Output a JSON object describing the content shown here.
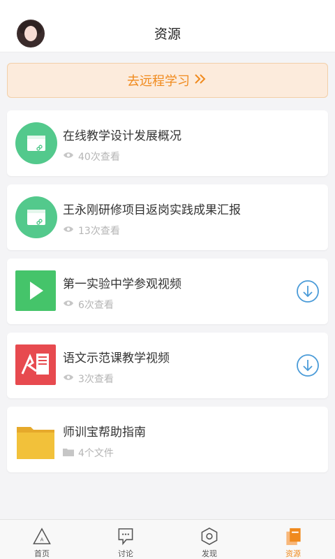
{
  "header": {
    "title": "资源",
    "avatar": "user-avatar"
  },
  "banner": {
    "label": "去远程学习",
    "icon": "double-chevron-right-icon",
    "color": "#f08a1d"
  },
  "resources": [
    {
      "title": "在线教学设计发展概况",
      "meta": "40次查看",
      "type": "web-link",
      "downloadable": false
    },
    {
      "title": "王永刚研修项目返岗实践成果汇报",
      "meta": "13次查看",
      "type": "web-link",
      "downloadable": false
    },
    {
      "title": "第一实验中学参观视频",
      "meta": "6次查看",
      "type": "video",
      "downloadable": true
    },
    {
      "title": "语文示范课教学视频",
      "meta": "3次查看",
      "type": "pdf",
      "downloadable": true
    },
    {
      "title": "师训宝帮助指南",
      "meta": "4个文件",
      "type": "folder",
      "downloadable": false
    }
  ],
  "tabs": [
    {
      "label": "首页",
      "icon": "home-triangle-icon",
      "active": false
    },
    {
      "label": "讨论",
      "icon": "discussion-icon",
      "active": false
    },
    {
      "label": "发现",
      "icon": "discover-hexagon-icon",
      "active": false
    },
    {
      "label": "资源",
      "icon": "resource-icon",
      "active": true
    }
  ],
  "colors": {
    "accent": "#f08a1d",
    "web_icon": "#53c98c",
    "video_icon": "#45c46a",
    "pdf_icon": "#e74a4f",
    "folder_icon": "#f2c13a",
    "download_icon": "#4a9bd8"
  }
}
